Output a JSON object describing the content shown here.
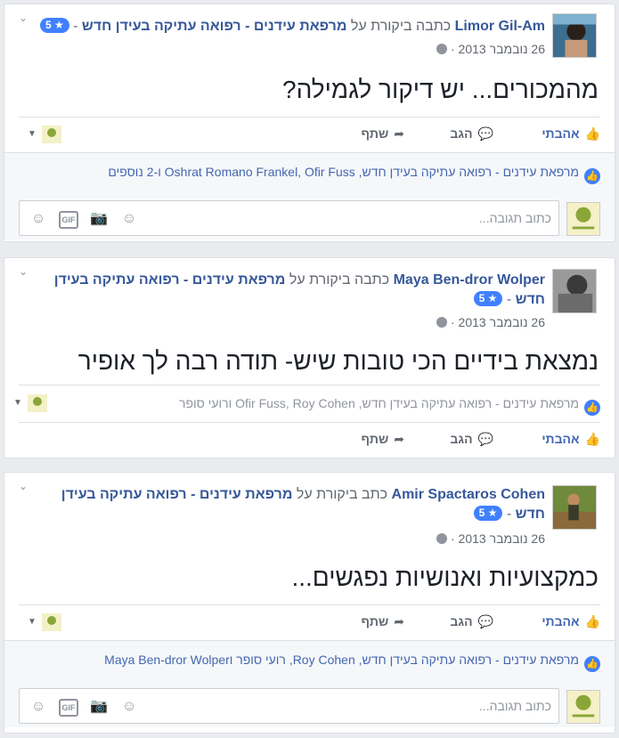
{
  "posts": [
    {
      "author": "Limor Gil-Am",
      "verb": "כתבה ביקורת על",
      "page": "מרפאת עידנים - רפואה עתיקה בעידן חדש",
      "rating": "5 ★",
      "date": "26 נובמבר 2013",
      "review": "מהמכורים... יש דיקור לגמילה?",
      "like": "אהבתי",
      "comment": "הגב",
      "share": "שתף",
      "reactions": "מרפאת עידנים - רפואה עתיקה בעידן חדש, Oshrat Romano Frankel, Ofir Fuss ו-2 נוספים",
      "placeholder": "כתוב תגובה..."
    },
    {
      "author": "Maya Ben-dror Wolper",
      "verb": "כתבה ביקורת על",
      "page": "מרפאת עידנים - רפואה עתיקה בעידן חדש",
      "rating": "5 ★",
      "date": "26 נובמבר 2013",
      "review": "נמצאת בידיים הכי טובות שיש- תודה רבה לך אופיר",
      "like": "אהבתי",
      "comment": "הגב",
      "share": "שתף",
      "reactions": "מרפאת עידנים - רפואה עתיקה בעידן חדש, Ofir Fuss, Roy Cohen ורועי סופר"
    },
    {
      "author": "Amir Spactaros Cohen",
      "verb": "כתב ביקורת על",
      "page": "מרפאת עידנים - רפואה עתיקה בעידן חדש",
      "rating": "5 ★",
      "date": "26 נובמבר 2013",
      "review": "כמקצועיות ואנושיות נפגשים...",
      "like": "אהבתי",
      "comment": "הגב",
      "share": "שתף",
      "reactions": "מרפאת עידנים - רפואה עתיקה בעידן חדש, Roy Cohen, רועי סופר וMaya Ben-dror Wolper",
      "placeholder": "כתוב תגובה..."
    }
  ]
}
